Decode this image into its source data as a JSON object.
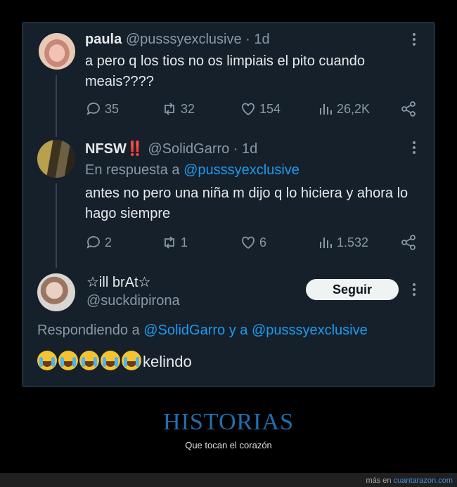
{
  "tweets": [
    {
      "name": "paula",
      "handle": "@pusssyexclusive · 1d",
      "text": "a pero q los tios no os limpiais el pito cuando meais????",
      "stats": {
        "replies": "35",
        "retweets": "32",
        "likes": "154",
        "views": "26,2K"
      }
    },
    {
      "name": "NFSW",
      "name_emoji": "‼️",
      "handle": "@SolidGarro · 1d",
      "reply_prefix": "En respuesta a ",
      "reply_to": "@pusssyexclusive",
      "text": "antes no pero una niña m dijo q lo hiciera y ahora lo hago siempre",
      "stats": {
        "replies": "2",
        "retweets": "1",
        "likes": "6",
        "views": "1.532"
      }
    },
    {
      "name": "☆ill brAt☆",
      "handle": "@suckdipirona",
      "follow_label": "Seguir",
      "reply_prefix": "Respondiendo a ",
      "reply_to_1": "@SolidGarro",
      "reply_join": " y a ",
      "reply_to_2": "@pusssyexclusive",
      "text": "kelindo",
      "emoji_count": 5
    }
  ],
  "headline": "HISTORIAS",
  "subline": "Que tocan el corazón",
  "footer": {
    "prefix": "más en ",
    "site": "cuantarazon.com"
  },
  "colors": {
    "background": "#15202b",
    "accent": "#1d9bf0",
    "muted": "#8b98a5",
    "headline": "#1f6fb0"
  },
  "icons": [
    "reply-icon",
    "retweet-icon",
    "like-icon",
    "views-icon",
    "share-icon",
    "more-icon",
    "crying-emoji-icon"
  ]
}
